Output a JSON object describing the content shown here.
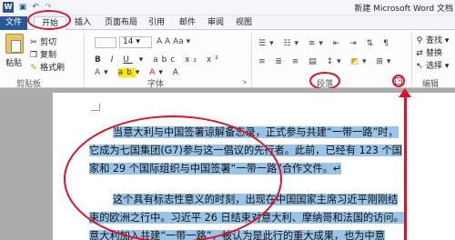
{
  "window": {
    "app_icon": "W",
    "title": "新建 Microsoft Word 文档"
  },
  "quick_access": {
    "icons": [
      "save-icon",
      "undo-icon",
      "redo-icon"
    ]
  },
  "tabs": [
    {
      "label": "文件"
    },
    {
      "label": "开始"
    },
    {
      "label": "插入"
    },
    {
      "label": "页面布局"
    },
    {
      "label": "引用"
    },
    {
      "label": "邮件"
    },
    {
      "label": "审阅"
    },
    {
      "label": "视图"
    }
  ],
  "ribbon": {
    "clipboard": {
      "label": "剪贴板",
      "paste": "粘贴",
      "cut": "剪切",
      "copy": "复制",
      "format_painter": "格式刷"
    },
    "font": {
      "label": "字体",
      "size_value": "14"
    },
    "paragraph": {
      "label": "段落"
    },
    "editing": {
      "label": "编辑",
      "find": "查找",
      "replace": "替换",
      "select": "选择"
    }
  },
  "document": {
    "para1_line1": "当意大利与中国签署谅解备忘录，正式参与共建“一带一路”时，",
    "para1_line2": "它成为七国集团(G7)参与这一倡议的先行者。此前，已经有 123 个国",
    "para1_line3": "家和 29 个国际组织与中国签署“一带一路”合作文件。↵",
    "para2_line1": "这个具有标志性意义的时刻，出现在中国国家主席习近平刚刚结",
    "para2_line2": "束的欧洲之行中。习近平 26 日结束对意大利、摩纳哥和法国的访问。",
    "para2_line3": "意大利加入共建“一带一路”，被认为是此行的重大成果，也为中意"
  },
  "colors": {
    "annotation": "#e0102a",
    "selection": "#99c4e8",
    "file_tab": "#2b5797"
  }
}
